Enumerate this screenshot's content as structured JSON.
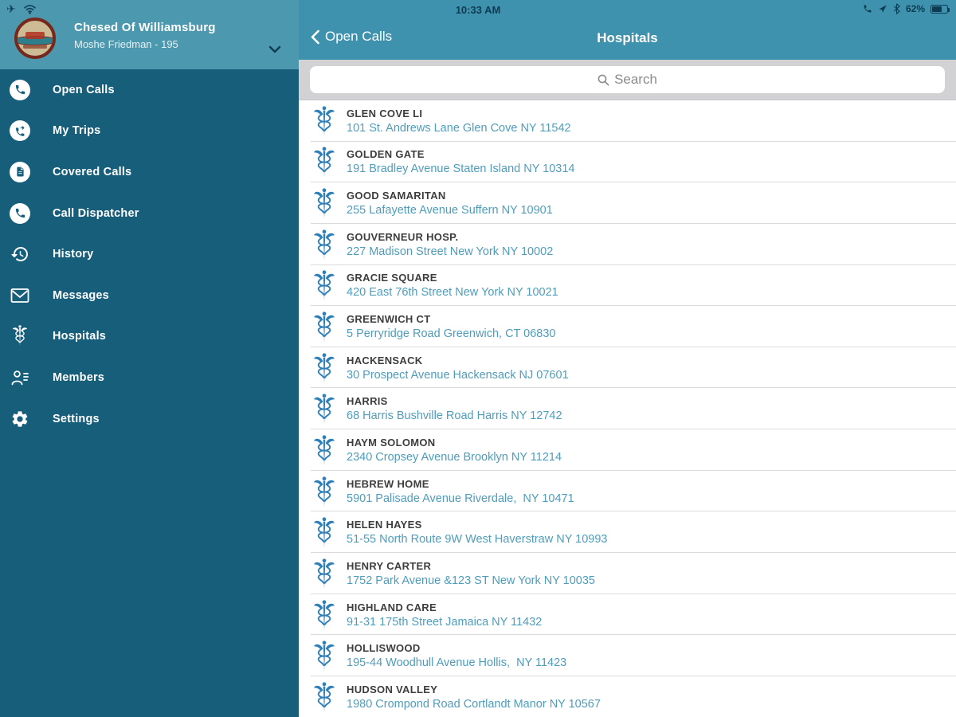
{
  "status_bar": {
    "time": "10:33 AM",
    "battery_percent": "62%",
    "left_icons": [
      "airplane-icon",
      "wifi-icon"
    ],
    "right_icons": [
      "phone-icon",
      "location-arrow-icon",
      "bluetooth-icon",
      "battery-icon"
    ]
  },
  "sidebar": {
    "org_name": "Chesed Of Williamsburg",
    "user_line": "Moshe Friedman - 195",
    "items": [
      {
        "icon": "phone-circle-icon",
        "label": "Open Calls"
      },
      {
        "icon": "trips-phone-circle-icon",
        "label": "My Trips"
      },
      {
        "icon": "covered-calls-circle-icon",
        "label": "Covered Calls"
      },
      {
        "icon": "dispatcher-phone-circle-icon",
        "label": "Call Dispatcher"
      },
      {
        "icon": "history-icon",
        "label": "History"
      },
      {
        "icon": "messages-icon",
        "label": "Messages"
      },
      {
        "icon": "hospitals-caduceus-icon",
        "label": "Hospitals"
      },
      {
        "icon": "members-icon",
        "label": "Members"
      },
      {
        "icon": "settings-gear-icon",
        "label": "Settings"
      }
    ]
  },
  "content": {
    "nav": {
      "back_label": "Open Calls",
      "title": "Hospitals"
    },
    "search_placeholder": "Search",
    "hospitals": [
      {
        "name": "GLEN COVE LI",
        "address": "101 St. Andrews Lane Glen Cove NY 11542"
      },
      {
        "name": "GOLDEN GATE",
        "address": "191 Bradley Avenue Staten Island NY 10314"
      },
      {
        "name": "GOOD SAMARITAN",
        "address": "255 Lafayette Avenue Suffern NY 10901"
      },
      {
        "name": "GOUVERNEUR HOSP.",
        "address": "227 Madison Street New York NY 10002"
      },
      {
        "name": "GRACIE SQUARE",
        "address": "420 East 76th Street New York NY 10021"
      },
      {
        "name": "GREENWICH CT",
        "address": "5 Perryridge Road Greenwich, CT 06830"
      },
      {
        "name": "HACKENSACK",
        "address": "30 Prospect Avenue Hackensack NJ 07601"
      },
      {
        "name": "HARRIS",
        "address": "68 Harris Bushville Road Harris NY 12742"
      },
      {
        "name": "HAYM SOLOMON",
        "address": "2340 Cropsey Avenue Brooklyn NY 11214"
      },
      {
        "name": "HEBREW HOME",
        "address": "5901 Palisade Avenue Riverdale,  NY 10471"
      },
      {
        "name": "HELEN HAYES",
        "address": "51-55 North Route 9W West Haverstraw NY 10993"
      },
      {
        "name": "HENRY CARTER",
        "address": "1752 Park Avenue &123 ST New York NY 10035"
      },
      {
        "name": "HIGHLAND CARE",
        "address": "91-31 175th Street Jamaica NY 11432"
      },
      {
        "name": "HOLLISWOOD",
        "address": "195-44 Woodhull Avenue Hollis,  NY 11423"
      },
      {
        "name": "HUDSON VALLEY",
        "address": "1980 Crompond Road Cortlandt Manor NY 10567"
      }
    ]
  },
  "colors": {
    "header_teal": "#4C98AE",
    "nav_teal": "#3F92AE",
    "sidebar_teal": "#175E7B",
    "status_dark": "#0D3B52",
    "address_blue": "#4F9DBB",
    "caduceus_blue": "#2E7FB8",
    "search_strip_gray": "#D2D2D4"
  }
}
